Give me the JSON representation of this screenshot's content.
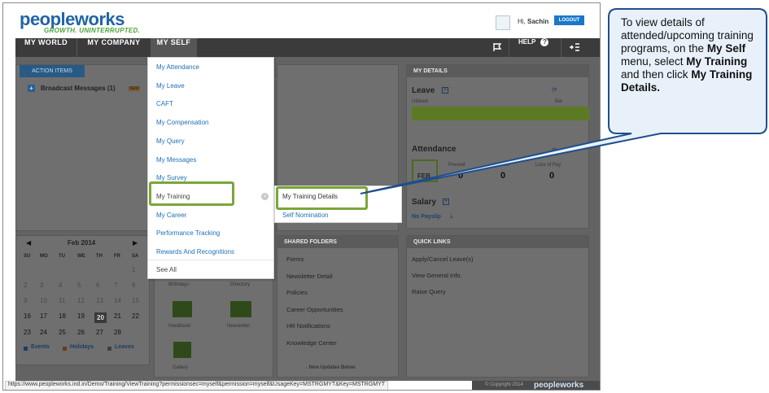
{
  "header": {
    "logo_text": "peopleworks",
    "tagline": "GROWTH. UNINTERRUPTED.",
    "greeting": "Hi,",
    "user_name": "Sachin",
    "logout_label": "LOGOUT"
  },
  "nav": {
    "items": [
      "MY WORLD",
      "MY COMPANY",
      "MY SELF"
    ],
    "help_label": "HELP",
    "help_icon": "question-circle-icon",
    "flag_icon": "flag-icon",
    "menu_icon": "collapse-menu-icon"
  },
  "action_items": {
    "tab_label": "ACTION ITEMS",
    "broadcast_label": "Broadcast Messages",
    "broadcast_count": "(1)",
    "new_badge": "NEW"
  },
  "calendar": {
    "month": "Feb 2014",
    "weekdays": [
      "SU",
      "MO",
      "TU",
      "WE",
      "TH",
      "FR",
      "SA"
    ],
    "rows": [
      [
        "",
        "",
        "",
        "",
        "",
        "",
        "1"
      ],
      [
        "2",
        "3",
        "4",
        "5",
        "6",
        "7",
        "8"
      ],
      [
        "9",
        "10",
        "11",
        "12",
        "13",
        "14",
        "15"
      ],
      [
        "16",
        "17",
        "18",
        "19",
        "20",
        "21",
        "22"
      ],
      [
        "23",
        "24",
        "25",
        "26",
        "27",
        "28",
        ""
      ]
    ],
    "today": "20",
    "legend": [
      "Events",
      "Holidays",
      "Leaves"
    ]
  },
  "apps": {
    "labels": [
      "Birthdays",
      "Directory",
      "Handbook",
      "Newsletter",
      "Gallery"
    ]
  },
  "shared_folders": {
    "title": "SHARED FOLDERS",
    "items": [
      "Forms",
      "Newsletter Detail",
      "Policies",
      "Career Opportunities",
      "HR Notifications",
      "Knowledge Center"
    ],
    "footer": "New Updates Below"
  },
  "my_details": {
    "title": "MY DETAILS",
    "leave_label": "Leave",
    "utilised_label": "Utilised",
    "balance_label": "Bal",
    "attendance_label": "Attendance",
    "att_month": "FEB",
    "att_cols": [
      "Present",
      "Leave",
      "Loss of Pay"
    ],
    "att_values": [
      "0",
      "0",
      "0"
    ],
    "salary_label": "Salary",
    "no_payslip": "No Payslip"
  },
  "quick_links": {
    "title": "QUICK LINKS",
    "items": [
      "Apply/Cancel Leave(s)",
      "View General Info.",
      "Raise Query"
    ]
  },
  "dropdown": {
    "items": [
      "My Attendance",
      "My Leave",
      "CAFT",
      "My Compensation",
      "My Query",
      "My Messages",
      "My Survey",
      "My Training",
      "My Career",
      "Performance Tracking",
      "Rewards And Recognitions",
      "See All"
    ]
  },
  "submenu": {
    "items": [
      "My Training Details",
      "Self Nomination"
    ]
  },
  "statusbar": {
    "url": "https://www.peopleworks.ind.in/Demo/Training/ViewTraining?permissionsec=myself&permission=myself&UsageKey=MSTRGMYT&Key=MSTRGMYT",
    "copyright": "© Copyright 2014",
    "footer_logo": "peopleworks"
  },
  "callout": {
    "line1": "To view details of attended/upcoming training programs, on the ",
    "menu_bold": "My Self",
    "line2": " menu, select ",
    "training_bold": "My  Training",
    "line3": " and then click ",
    "details_bold": "My Training Details."
  },
  "colors": {
    "brand_blue": "#1f64a8",
    "highlight_green": "#7aa63a",
    "callout_fill": "#e8f1fa",
    "callout_border": "#1f4e8c"
  }
}
